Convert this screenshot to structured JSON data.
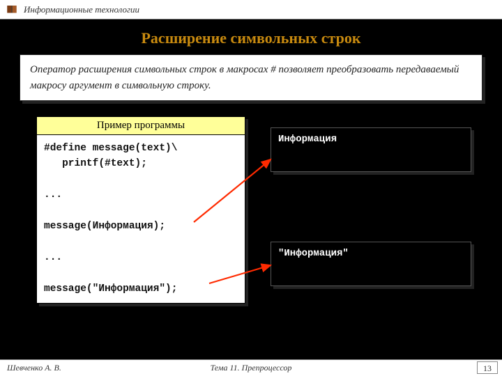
{
  "header": {
    "label": "Информационные технологии"
  },
  "title": "Расширение символьных строк",
  "description": "Оператор расширения символьных строк в макросах # позволяет преобразовать передаваемый макросу аргумент в символьную строку.",
  "code": {
    "title": "Пример программы",
    "body": "#define message(text)\\\n   printf(#text);\n\n...\n\nmessage(Информация);\n\n...\n\nmessage(\"Информация\");"
  },
  "output1": "Информация",
  "output2": "\"Информация\"",
  "footer": {
    "author": "Шевченко А. В.",
    "topic": "Тема 11. Препроцессор",
    "page": "13"
  },
  "colors": {
    "accent": "#c88a0f",
    "arrow": "#ff2a00"
  }
}
